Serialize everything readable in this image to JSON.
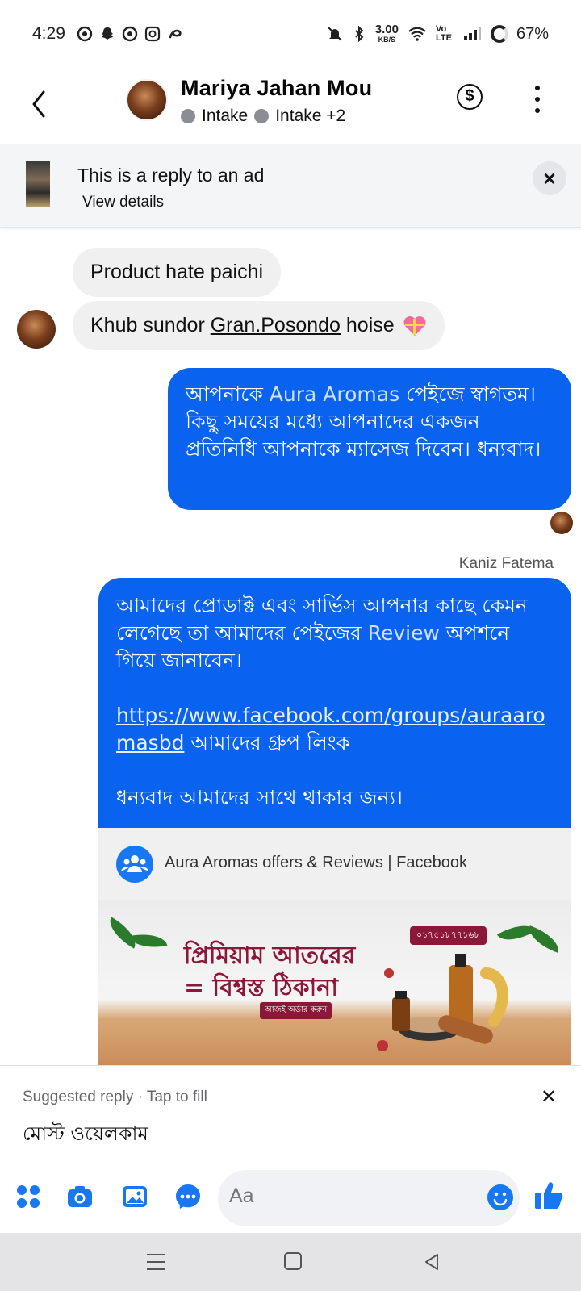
{
  "status": {
    "time": "4:29",
    "net_speed_value": "3.00",
    "net_speed_unit": "KB/S",
    "volte": "Vo LTE",
    "battery": "67%"
  },
  "header": {
    "contact_name": "Mariya Jahan Mou",
    "label_1": "Intake",
    "label_2": "Intake +2"
  },
  "ad_banner": {
    "title": "This is a reply to an ad",
    "subtitle": "View details"
  },
  "messages": {
    "incoming_1": "Product hate paichi",
    "incoming_2_prefix": "Khub sundor ",
    "incoming_2_link": "Gran.Posondo",
    "incoming_2_suffix": " hoise",
    "outgoing_1_part1": "আপনাকে ",
    "outgoing_1_highlight": "Aura Aromas",
    "outgoing_1_part2": " পেইজে স্বাগতম। কিছু সময়ের মধ্যে আপনাদের একজন প্রতিনিধি আপনাকে ম্যাসেজ দিবেন। ধন্যবাদ।",
    "sender_name": "Kaniz Fatema",
    "outgoing_2_part1": "আমাদের প্রোডাক্ট এবং সার্ভিস আপনার কাছে কেমন লেগেছে তা আমাদের পেইজের ",
    "outgoing_2_highlight": "Review",
    "outgoing_2_part2": " অপশনে গিয়ে জানাবেন।",
    "outgoing_2_link": "https://www.facebook.com/groups/auraaromasbd",
    "outgoing_2_link_suffix": " আমাদের গ্রুপ লিংক",
    "outgoing_2_thanks": "ধন্যবাদ আমাদের সাথে থাকার জন্য।"
  },
  "link_preview": {
    "title": "Aura Aromas offers & Reviews | Facebook",
    "image_line_1": "প্রিমিয়াম আতরের",
    "image_line_2": "= বিশ্বস্ত ঠিকানা",
    "image_badge": "আজই অর্ডার করুন",
    "image_phone": "০১৭৫১৮৭৭১৬৮"
  },
  "suggested_reply": {
    "label": "Suggested reply · Tap to fill",
    "text": "মোস্ট ওয়েলকাম"
  },
  "composer": {
    "placeholder": "Aa"
  },
  "colors": {
    "outgoing_bubble": "#0a63ee",
    "incoming_bubble": "#f0f0f0",
    "accent": "#1877f2"
  }
}
